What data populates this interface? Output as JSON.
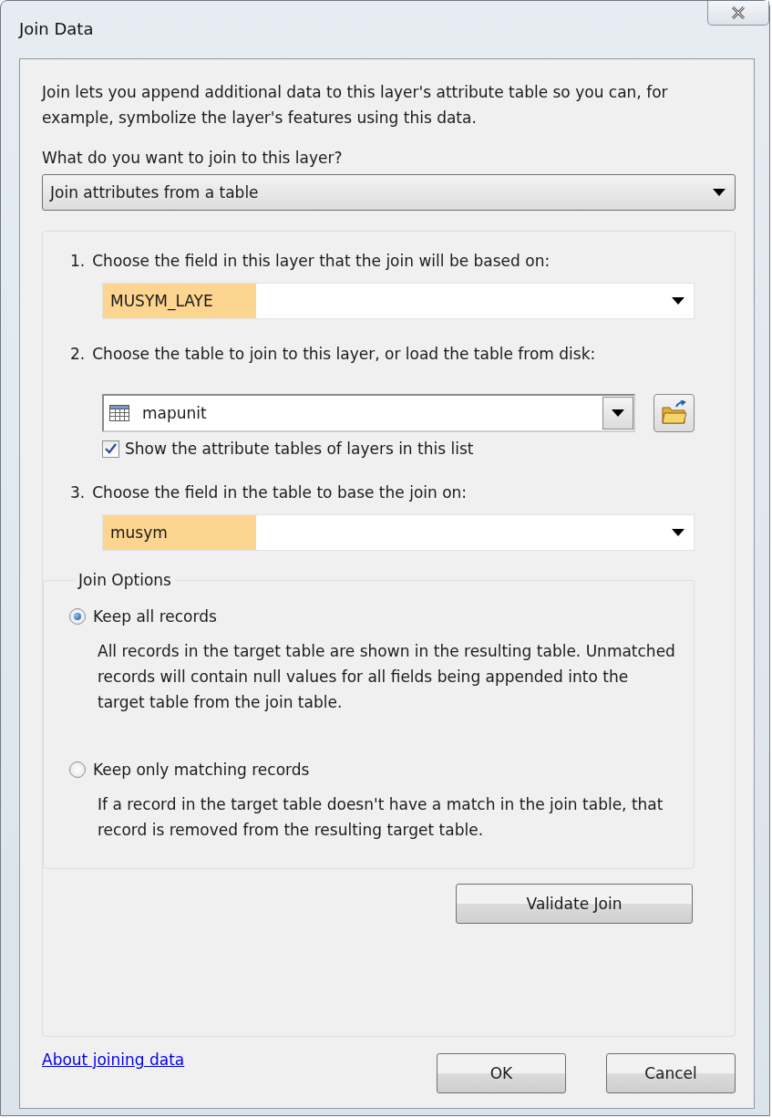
{
  "window": {
    "title": "Join Data"
  },
  "intro": "Join lets you append additional data to this layer's attribute table so you can, for example, symbolize the layer's features using this data.",
  "join_type": {
    "label": "What do you want to join to this layer?",
    "value": "Join attributes from a table"
  },
  "steps": [
    {
      "kind": "field",
      "number": "1.",
      "label": "Choose the field in this layer that the join will be based on:",
      "value": "MUSYM_LAYE"
    },
    {
      "kind": "table",
      "number": "2.",
      "label": "Choose the table to join to this layer, or load the table from disk:",
      "value": "mapunit",
      "checkbox": {
        "label": "Show the attribute tables of layers in this list",
        "checked": true
      }
    },
    {
      "kind": "field",
      "number": "3.",
      "label": "Choose the field in the table to base the join on:",
      "value": "musym"
    }
  ],
  "join_options": {
    "title": "Join Options",
    "options": [
      {
        "label": "Keep all records",
        "selected": true,
        "description": "All records in the target table are shown in the resulting table. Unmatched records will contain null values for all fields being appended into the target table from the join table."
      },
      {
        "label": "Keep only matching records",
        "selected": false,
        "description": "If a record in the target table doesn't have a match in the join table, that record is removed from the resulting target table."
      }
    ]
  },
  "validate_button": "Validate Join",
  "link": "About joining data",
  "buttons": [
    "OK",
    "Cancel"
  ]
}
